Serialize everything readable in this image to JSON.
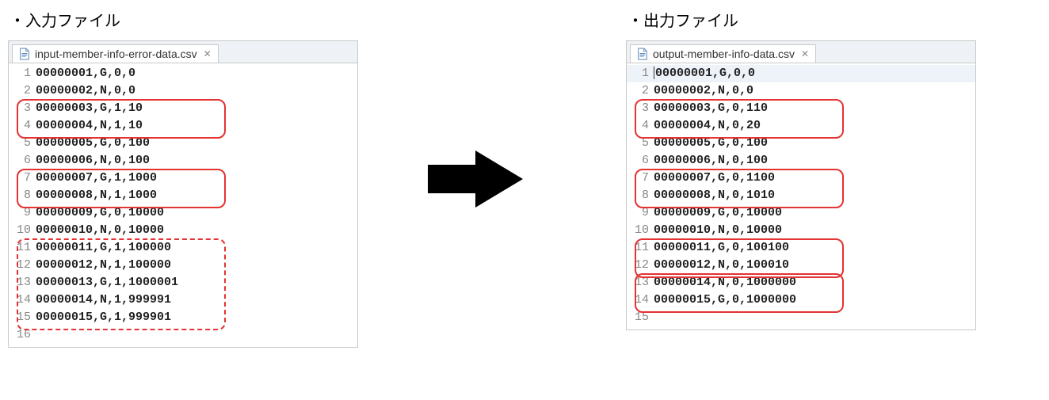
{
  "left": {
    "heading": "・入力ファイル",
    "tab_name": "input-member-info-error-data.csv",
    "lines": [
      {
        "n": "1",
        "t": "00000001,G,0,0"
      },
      {
        "n": "2",
        "t": "00000002,N,0,0"
      },
      {
        "n": "3",
        "t": "00000003,G,1,10"
      },
      {
        "n": "4",
        "t": "00000004,N,1,10"
      },
      {
        "n": "5",
        "t": "00000005,G,0,100"
      },
      {
        "n": "6",
        "t": "00000006,N,0,100"
      },
      {
        "n": "7",
        "t": "00000007,G,1,1000"
      },
      {
        "n": "8",
        "t": "00000008,N,1,1000"
      },
      {
        "n": "9",
        "t": "00000009,G,0,10000"
      },
      {
        "n": "10",
        "t": "00000010,N,0,10000"
      },
      {
        "n": "11",
        "t": "00000011,G,1,100000"
      },
      {
        "n": "12",
        "t": "00000012,N,1,100000"
      },
      {
        "n": "13",
        "t": "00000013,G,1,1000001"
      },
      {
        "n": "14",
        "t": "00000014,N,1,999991"
      },
      {
        "n": "15",
        "t": "00000015,G,1,999901"
      },
      {
        "n": "16",
        "t": ""
      }
    ],
    "highlights": [
      {
        "from": 3,
        "to": 4,
        "style": "solid"
      },
      {
        "from": 7,
        "to": 8,
        "style": "solid"
      },
      {
        "from": 11,
        "to": 15,
        "style": "dashed"
      }
    ]
  },
  "right": {
    "heading": "・出力ファイル",
    "tab_name": "output-member-info-data.csv",
    "lines": [
      {
        "n": "1",
        "t": "00000001,G,0,0",
        "cursor": true
      },
      {
        "n": "2",
        "t": "00000002,N,0,0"
      },
      {
        "n": "3",
        "t": "00000003,G,0,110"
      },
      {
        "n": "4",
        "t": "00000004,N,0,20"
      },
      {
        "n": "5",
        "t": "00000005,G,0,100"
      },
      {
        "n": "6",
        "t": "00000006,N,0,100"
      },
      {
        "n": "7",
        "t": "00000007,G,0,1100"
      },
      {
        "n": "8",
        "t": "00000008,N,0,1010"
      },
      {
        "n": "9",
        "t": "00000009,G,0,10000"
      },
      {
        "n": "10",
        "t": "00000010,N,0,10000"
      },
      {
        "n": "11",
        "t": "00000011,G,0,100100"
      },
      {
        "n": "12",
        "t": "00000012,N,0,100010"
      },
      {
        "n": "13",
        "t": "00000014,N,0,1000000"
      },
      {
        "n": "14",
        "t": "00000015,G,0,1000000"
      },
      {
        "n": "15",
        "t": ""
      }
    ],
    "highlights": [
      {
        "from": 3,
        "to": 4,
        "style": "solid"
      },
      {
        "from": 7,
        "to": 8,
        "style": "solid"
      },
      {
        "from": 11,
        "to": 12,
        "style": "solid"
      },
      {
        "from": 13,
        "to": 14,
        "style": "solid"
      }
    ]
  }
}
